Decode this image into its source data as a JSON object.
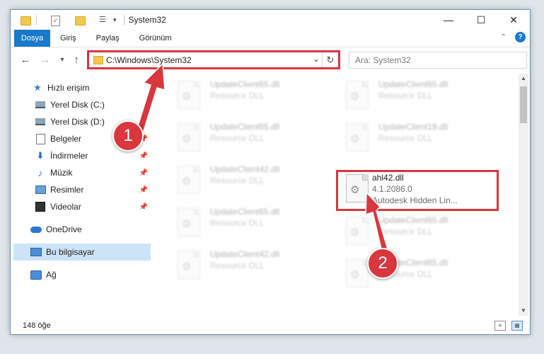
{
  "window": {
    "title": "System32",
    "controls": {
      "minimize": "—",
      "maximize": "☐",
      "close": "✕"
    }
  },
  "quick_access_toolbar": {
    "icons": [
      "folder-icon",
      "properties-check-icon",
      "new-folder-icon",
      "properties-icon"
    ],
    "dropdown": "▾"
  },
  "ribbon": {
    "file_tab": "Dosya",
    "tabs": [
      "Giriş",
      "Paylaş",
      "Görünüm"
    ]
  },
  "navigation": {
    "back": "←",
    "forward": "→",
    "recent": "▾",
    "up": "↑",
    "address": "C:\\Windows\\System32",
    "address_dropdown": "⌄",
    "refresh": "↻",
    "search_placeholder": "Ara: System32"
  },
  "sidebar": {
    "items": [
      {
        "label": "Hızlı erişim",
        "icon": "star-icon",
        "pinned": false
      },
      {
        "label": "Yerel Disk (C:)",
        "icon": "drive-icon",
        "pinned": true
      },
      {
        "label": "Yerel Disk (D:)",
        "icon": "drive-icon",
        "pinned": true
      },
      {
        "label": "Belgeler",
        "icon": "documents-icon",
        "pinned": true
      },
      {
        "label": "İndirmeler",
        "icon": "download-icon",
        "pinned": true
      },
      {
        "label": "Müzik",
        "icon": "music-icon",
        "pinned": true
      },
      {
        "label": "Resimler",
        "icon": "pictures-icon",
        "pinned": true
      },
      {
        "label": "Videolar",
        "icon": "videos-icon",
        "pinned": true
      },
      {
        "label": "OneDrive",
        "icon": "cloud-icon",
        "pinned": false
      },
      {
        "label": "Bu bilgisayar",
        "icon": "computer-icon",
        "pinned": false,
        "selected": true
      },
      {
        "label": "Ağ",
        "icon": "network-icon",
        "pinned": false
      }
    ]
  },
  "files": [
    {
      "name": "UpdateClient65.dll",
      "type": "Resource DLL",
      "blurred": true
    },
    {
      "name": "UpdateClient65.dll",
      "type": "Resource DLL",
      "blurred": true
    },
    {
      "name": "UpdateClient65.dll",
      "type": "Resource DLL",
      "blurred": true
    },
    {
      "name": "UpdateClient19.dll",
      "type": "Resource DLL",
      "blurred": true
    },
    {
      "name": "UpdateClient42.dll",
      "type": "Resource DLL",
      "blurred": true
    },
    {
      "name": "ahl42.dll",
      "version": "4.1.2086.0",
      "description": "Autodesk Hidden Lin...",
      "blurred": false
    },
    {
      "name": "UpdateClient65.dll",
      "type": "Resource DLL",
      "blurred": true
    },
    {
      "name": "UpdateClient65.dll",
      "type": "Resource DLL",
      "blurred": true
    },
    {
      "name": "UpdateClient42.dll",
      "type": "Resource DLL",
      "blurred": true
    },
    {
      "name": "UpdateClient65.dll",
      "type": "Resource DLL",
      "blurred": true
    }
  ],
  "status": {
    "count": "148 öğe"
  },
  "annotations": {
    "step1": "1",
    "step2": "2",
    "color": "#d9363e"
  },
  "colors": {
    "accent": "#1979ca",
    "selection": "#cce4f7",
    "highlight": "#d9363e"
  }
}
